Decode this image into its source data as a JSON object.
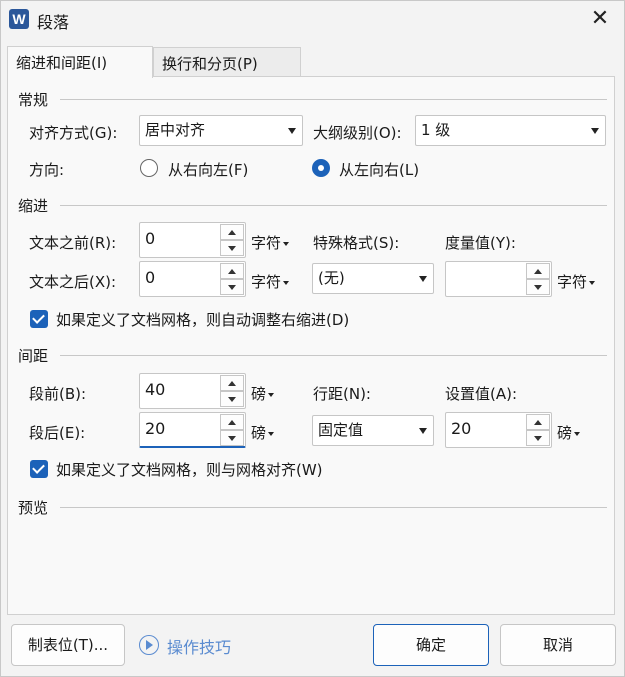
{
  "window": {
    "title": "段落",
    "app_icon_letter": "W",
    "close_glyph": "✕"
  },
  "tabs": [
    {
      "label": "缩进和间距(I)",
      "active": true
    },
    {
      "label": "换行和分页(P)",
      "active": false
    }
  ],
  "general": {
    "section_title": "常规",
    "alignment_label": "对齐方式(G):",
    "alignment_value": "居中对齐",
    "outline_label": "大纲级别(O):",
    "outline_value": "1 级",
    "direction_label": "方向:",
    "rtl_label": "从右向左(F)",
    "ltr_label": "从左向右(L)",
    "direction_selected": "ltr"
  },
  "indent": {
    "section_title": "缩进",
    "before_label": "文本之前(R):",
    "before_value": "0",
    "before_unit": "字符",
    "after_label": "文本之后(X):",
    "after_value": "0",
    "after_unit": "字符",
    "special_label": "特殊格式(S):",
    "special_value": "(无)",
    "measure_label": "度量值(Y):",
    "measure_value": "",
    "measure_unit": "字符",
    "auto_adjust_label": "如果定义了文档网格，则自动调整右缩进(D)",
    "auto_adjust_checked": true
  },
  "spacing": {
    "section_title": "间距",
    "before_label": "段前(B):",
    "before_value": "40",
    "before_unit": "磅",
    "after_label": "段后(E):",
    "after_value": "20",
    "after_unit": "磅",
    "line_label": "行距(N):",
    "line_value": "固定值",
    "setting_label": "设置值(A):",
    "setting_value": "20",
    "setting_unit": "磅",
    "snap_grid_label": "如果定义了文档网格，则与网格对齐(W)",
    "snap_grid_checked": true
  },
  "preview": {
    "section_title": "预览"
  },
  "footer": {
    "tabs_button": "制表位(T)...",
    "tips_label": "操作技巧",
    "ok_button": "确定",
    "cancel_button": "取消"
  },
  "colors": {
    "accent": "#1c62b9",
    "tips": "#5a8bd0",
    "app_icon": "#2b579a"
  }
}
